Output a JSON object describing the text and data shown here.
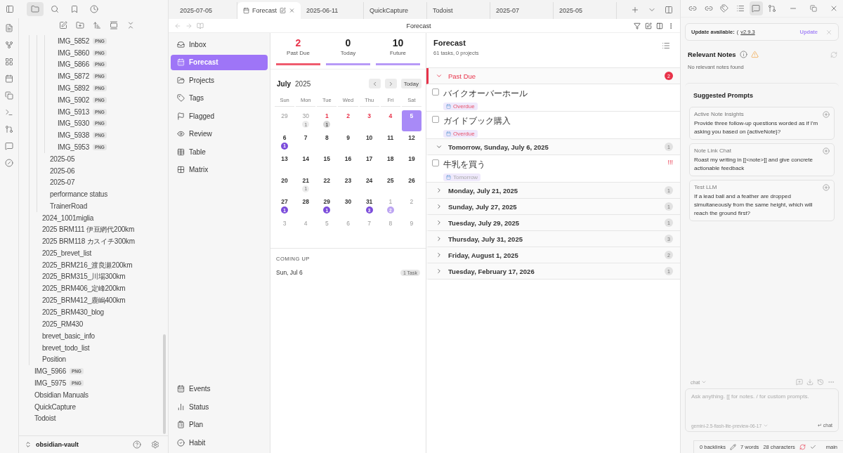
{
  "left_tabs": [
    {
      "selected": true
    },
    {
      "selected": false
    },
    {
      "selected": false
    },
    {
      "selected": false
    }
  ],
  "file_tree": [
    {
      "children": [
        {
          "children": [
            {
              "children": [
                {
                  "label": "IMG_5852",
                  "badge": "PNG"
                },
                {
                  "label": "IMG_5860",
                  "badge": "PNG"
                },
                {
                  "label": "IMG_5866",
                  "badge": "PNG"
                },
                {
                  "label": "IMG_5872",
                  "badge": "PNG"
                },
                {
                  "label": "IMG_5892",
                  "badge": "PNG"
                },
                {
                  "label": "IMG_5902",
                  "badge": "PNG"
                },
                {
                  "label": "IMG_5913",
                  "badge": "PNG"
                },
                {
                  "label": "IMG_5930",
                  "badge": "PNG"
                },
                {
                  "label": "IMG_5938",
                  "badge": "PNG"
                },
                {
                  "label": "IMG_5953",
                  "badge": "PNG"
                }
              ]
            },
            {
              "label": "2025-05"
            },
            {
              "label": "2025-06"
            },
            {
              "label": "2025-07"
            },
            {
              "label": "performance status"
            },
            {
              "label": "TrainerRoad"
            }
          ]
        },
        {
          "label": "2024_1001miglia"
        },
        {
          "label": "2025 BRM111 伊豆網代200km"
        },
        {
          "label": "2025 BRM118 カスイチ300km"
        },
        {
          "label": "2025_brevet_list"
        },
        {
          "label": "2025_BRM216_渡良瀬200km"
        },
        {
          "label": "2025_BRM315_川場300km"
        },
        {
          "label": "2025_BRM406_定峰200km"
        },
        {
          "label": "2025_BRM412_鹿嶋400km"
        },
        {
          "label": "2025_BRM430_blog"
        },
        {
          "label": "2025_RM430"
        },
        {
          "label": "brevet_basic_info"
        },
        {
          "label": "brevet_todo_list"
        },
        {
          "label": "Position"
        }
      ]
    },
    {
      "label": "IMG_5966",
      "badge": "PNG"
    },
    {
      "label": "IMG_5975",
      "badge": "PNG"
    },
    {
      "label": "Obsidian Manuals"
    },
    {
      "label": "QuickCapture"
    },
    {
      "label": "Todoist"
    }
  ],
  "vault": {
    "name": "obsidian-vault"
  },
  "tabs": [
    {
      "label": "2025-07-05",
      "selected": false
    },
    {
      "label": "Forecast",
      "selected": true
    },
    {
      "label": "2025-06-11",
      "selected": false
    },
    {
      "label": "QuickCapture",
      "selected": false
    },
    {
      "label": "Todoist",
      "selected": false
    },
    {
      "label": "2025-07",
      "selected": false
    },
    {
      "label": "2025-05",
      "selected": false
    }
  ],
  "view_title": "Forecast",
  "nav": {
    "items": [
      {
        "label": "Inbox",
        "selected": false
      },
      {
        "label": "Forecast",
        "selected": true
      },
      {
        "label": "Projects",
        "selected": false
      },
      {
        "label": "Tags",
        "selected": false
      },
      {
        "label": "Flagged",
        "selected": false
      },
      {
        "label": "Review",
        "selected": false
      },
      {
        "label": "Table",
        "selected": false
      },
      {
        "label": "Matrix",
        "selected": false
      }
    ],
    "bottom_items": [
      {
        "label": "Events",
        "selected": false
      },
      {
        "label": "Status",
        "selected": false
      },
      {
        "label": "Plan",
        "selected": false
      },
      {
        "label": "Habit",
        "selected": false
      }
    ]
  },
  "stats": [
    {
      "value": "2",
      "label": "Past Due",
      "kind": "danger"
    },
    {
      "value": "0",
      "label": "Today",
      "kind": "normal"
    },
    {
      "value": "10",
      "label": "Future",
      "kind": "normal"
    }
  ],
  "calendar": {
    "month": "July",
    "year": "2025",
    "today_button": "Today",
    "weekdays": [
      "Sun",
      "Mon",
      "Tue",
      "Wed",
      "Thu",
      "Fri",
      "Sat"
    ],
    "weeks": [
      [
        {
          "label": "29",
          "kind": "other",
          "selected": false
        },
        {
          "label": "30",
          "kind": "other",
          "selected": false,
          "badge": {
            "text": "1",
            "kind": "faint"
          }
        },
        {
          "label": "1",
          "kind": "overdue",
          "selected": false,
          "badge": {
            "text": "1",
            "kind": "grey"
          }
        },
        {
          "label": "2",
          "kind": "overdue",
          "selected": false
        },
        {
          "label": "3",
          "kind": "overdue",
          "selected": false
        },
        {
          "label": "4",
          "kind": "overdue",
          "selected": false
        },
        {
          "label": "5",
          "kind": "current",
          "selected": true
        }
      ],
      [
        {
          "label": "6",
          "kind": "current",
          "selected": false,
          "badge": {
            "text": "1",
            "kind": "purple"
          }
        },
        {
          "label": "7",
          "kind": "current",
          "selected": false
        },
        {
          "label": "8",
          "kind": "current",
          "selected": false
        },
        {
          "label": "9",
          "kind": "current",
          "selected": false
        },
        {
          "label": "10",
          "kind": "current",
          "selected": false
        },
        {
          "label": "11",
          "kind": "current",
          "selected": false
        },
        {
          "label": "12",
          "kind": "current",
          "selected": false
        }
      ],
      [
        {
          "label": "13",
          "kind": "current",
          "selected": false
        },
        {
          "label": "14",
          "kind": "current",
          "selected": false
        },
        {
          "label": "15",
          "kind": "current",
          "selected": false
        },
        {
          "label": "16",
          "kind": "current",
          "selected": false
        },
        {
          "label": "17",
          "kind": "current",
          "selected": false
        },
        {
          "label": "18",
          "kind": "current",
          "selected": false
        },
        {
          "label": "19",
          "kind": "current",
          "selected": false
        }
      ],
      [
        {
          "label": "20",
          "kind": "current",
          "selected": false
        },
        {
          "label": "21",
          "kind": "current",
          "selected": false,
          "badge": {
            "text": "1",
            "kind": "faint"
          }
        },
        {
          "label": "22",
          "kind": "current",
          "selected": false
        },
        {
          "label": "23",
          "kind": "current",
          "selected": false
        },
        {
          "label": "24",
          "kind": "current",
          "selected": false
        },
        {
          "label": "25",
          "kind": "current",
          "selected": false
        },
        {
          "label": "26",
          "kind": "current",
          "selected": false
        }
      ],
      [
        {
          "label": "27",
          "kind": "current",
          "selected": false,
          "badge": {
            "text": "1",
            "kind": "purple"
          }
        },
        {
          "label": "28",
          "kind": "current",
          "selected": false
        },
        {
          "label": "29",
          "kind": "current",
          "selected": false,
          "badge": {
            "text": "1",
            "kind": "purple"
          }
        },
        {
          "label": "30",
          "kind": "current",
          "selected": false
        },
        {
          "label": "31",
          "kind": "current",
          "selected": false,
          "badge": {
            "text": "3",
            "kind": "purple"
          }
        },
        {
          "label": "1",
          "kind": "other",
          "selected": false,
          "badge": {
            "text": "2",
            "kind": "lilac"
          }
        },
        {
          "label": "2",
          "kind": "other",
          "selected": false
        }
      ],
      [
        {
          "label": "3",
          "kind": "other",
          "selected": false
        },
        {
          "label": "4",
          "kind": "other",
          "selected": false
        },
        {
          "label": "5",
          "kind": "other",
          "selected": false
        },
        {
          "label": "6",
          "kind": "other",
          "selected": false
        },
        {
          "label": "7",
          "kind": "other",
          "selected": false
        },
        {
          "label": "8",
          "kind": "other",
          "selected": false
        },
        {
          "label": "9",
          "kind": "other",
          "selected": false
        }
      ]
    ]
  },
  "coming_up": {
    "title": "COMING UP",
    "items": [
      {
        "date": "Sun, Jul 6",
        "count": "1 Task"
      }
    ]
  },
  "forecast": {
    "title": "Forecast",
    "subtitle": "61 tasks, 0 projects",
    "sections": [
      {
        "title": "Past Due",
        "kind": "overdue",
        "expanded": true,
        "count": "2",
        "tasks": [
          {
            "title": "バイクオーバーホール",
            "checked": false,
            "tag": {
              "text": "Overdue",
              "kind": "overdue"
            }
          },
          {
            "title": "ガイドブック購入",
            "checked": false,
            "tag": {
              "text": "Overdue",
              "kind": "overdue"
            }
          }
        ]
      },
      {
        "title": "Tomorrow, Sunday, July 6, 2025",
        "kind": "date",
        "expanded": true,
        "count": "1",
        "tasks": [
          {
            "title": "牛乳を買う",
            "checked": false,
            "tag": {
              "text": "Tomorrow",
              "kind": "upcoming"
            },
            "priority": "!!!"
          }
        ]
      },
      {
        "title": "Monday, July 21, 2025",
        "kind": "date",
        "expanded": false,
        "count": "1"
      },
      {
        "title": "Sunday, July 27, 2025",
        "kind": "date",
        "expanded": false,
        "count": "1"
      },
      {
        "title": "Tuesday, July 29, 2025",
        "kind": "date",
        "expanded": false,
        "count": "1"
      },
      {
        "title": "Thursday, July 31, 2025",
        "kind": "date",
        "expanded": false,
        "count": "3"
      },
      {
        "title": "Friday, August 1, 2025",
        "kind": "date",
        "expanded": false,
        "count": "2"
      },
      {
        "title": "Tuesday, February 17, 2026",
        "kind": "date",
        "expanded": false,
        "count": "1"
      }
    ]
  },
  "right_tabs": [
    {
      "selected": false
    },
    {
      "selected": false
    },
    {
      "selected": false
    },
    {
      "selected": false
    },
    {
      "selected": true
    },
    {
      "selected": false
    }
  ],
  "update": {
    "label": "Update available:",
    "paren": "(",
    "version": "v2.9.3",
    "button": "Update"
  },
  "relevant_notes": {
    "title": "Relevant Notes",
    "empty": "No relevant notes found"
  },
  "suggested": {
    "title": "Suggested Prompts",
    "prompts": [
      {
        "title": "Active Note Insights",
        "text": "Provide three follow-up questions worded as if I'm asking you based on {activeNote}?"
      },
      {
        "title": "Note Link Chat",
        "text": "Roast my writing in [[<note>]] and give concrete actionable feedback"
      },
      {
        "title": "Test LLM",
        "text": "If a lead ball and a feather are dropped simultaneously from the same height, which will reach the ground first?"
      }
    ]
  },
  "chat": {
    "mode": "chat",
    "placeholder": "Ask anything. [[ for notes. / for custom prompts.",
    "model": "gemini-2.5-flash-lite-preview-06-17",
    "send": "↵ chat"
  },
  "status_bar": {
    "backlinks": "0 backlinks",
    "words": "7 words",
    "characters": "28 characters",
    "branch": "main"
  }
}
